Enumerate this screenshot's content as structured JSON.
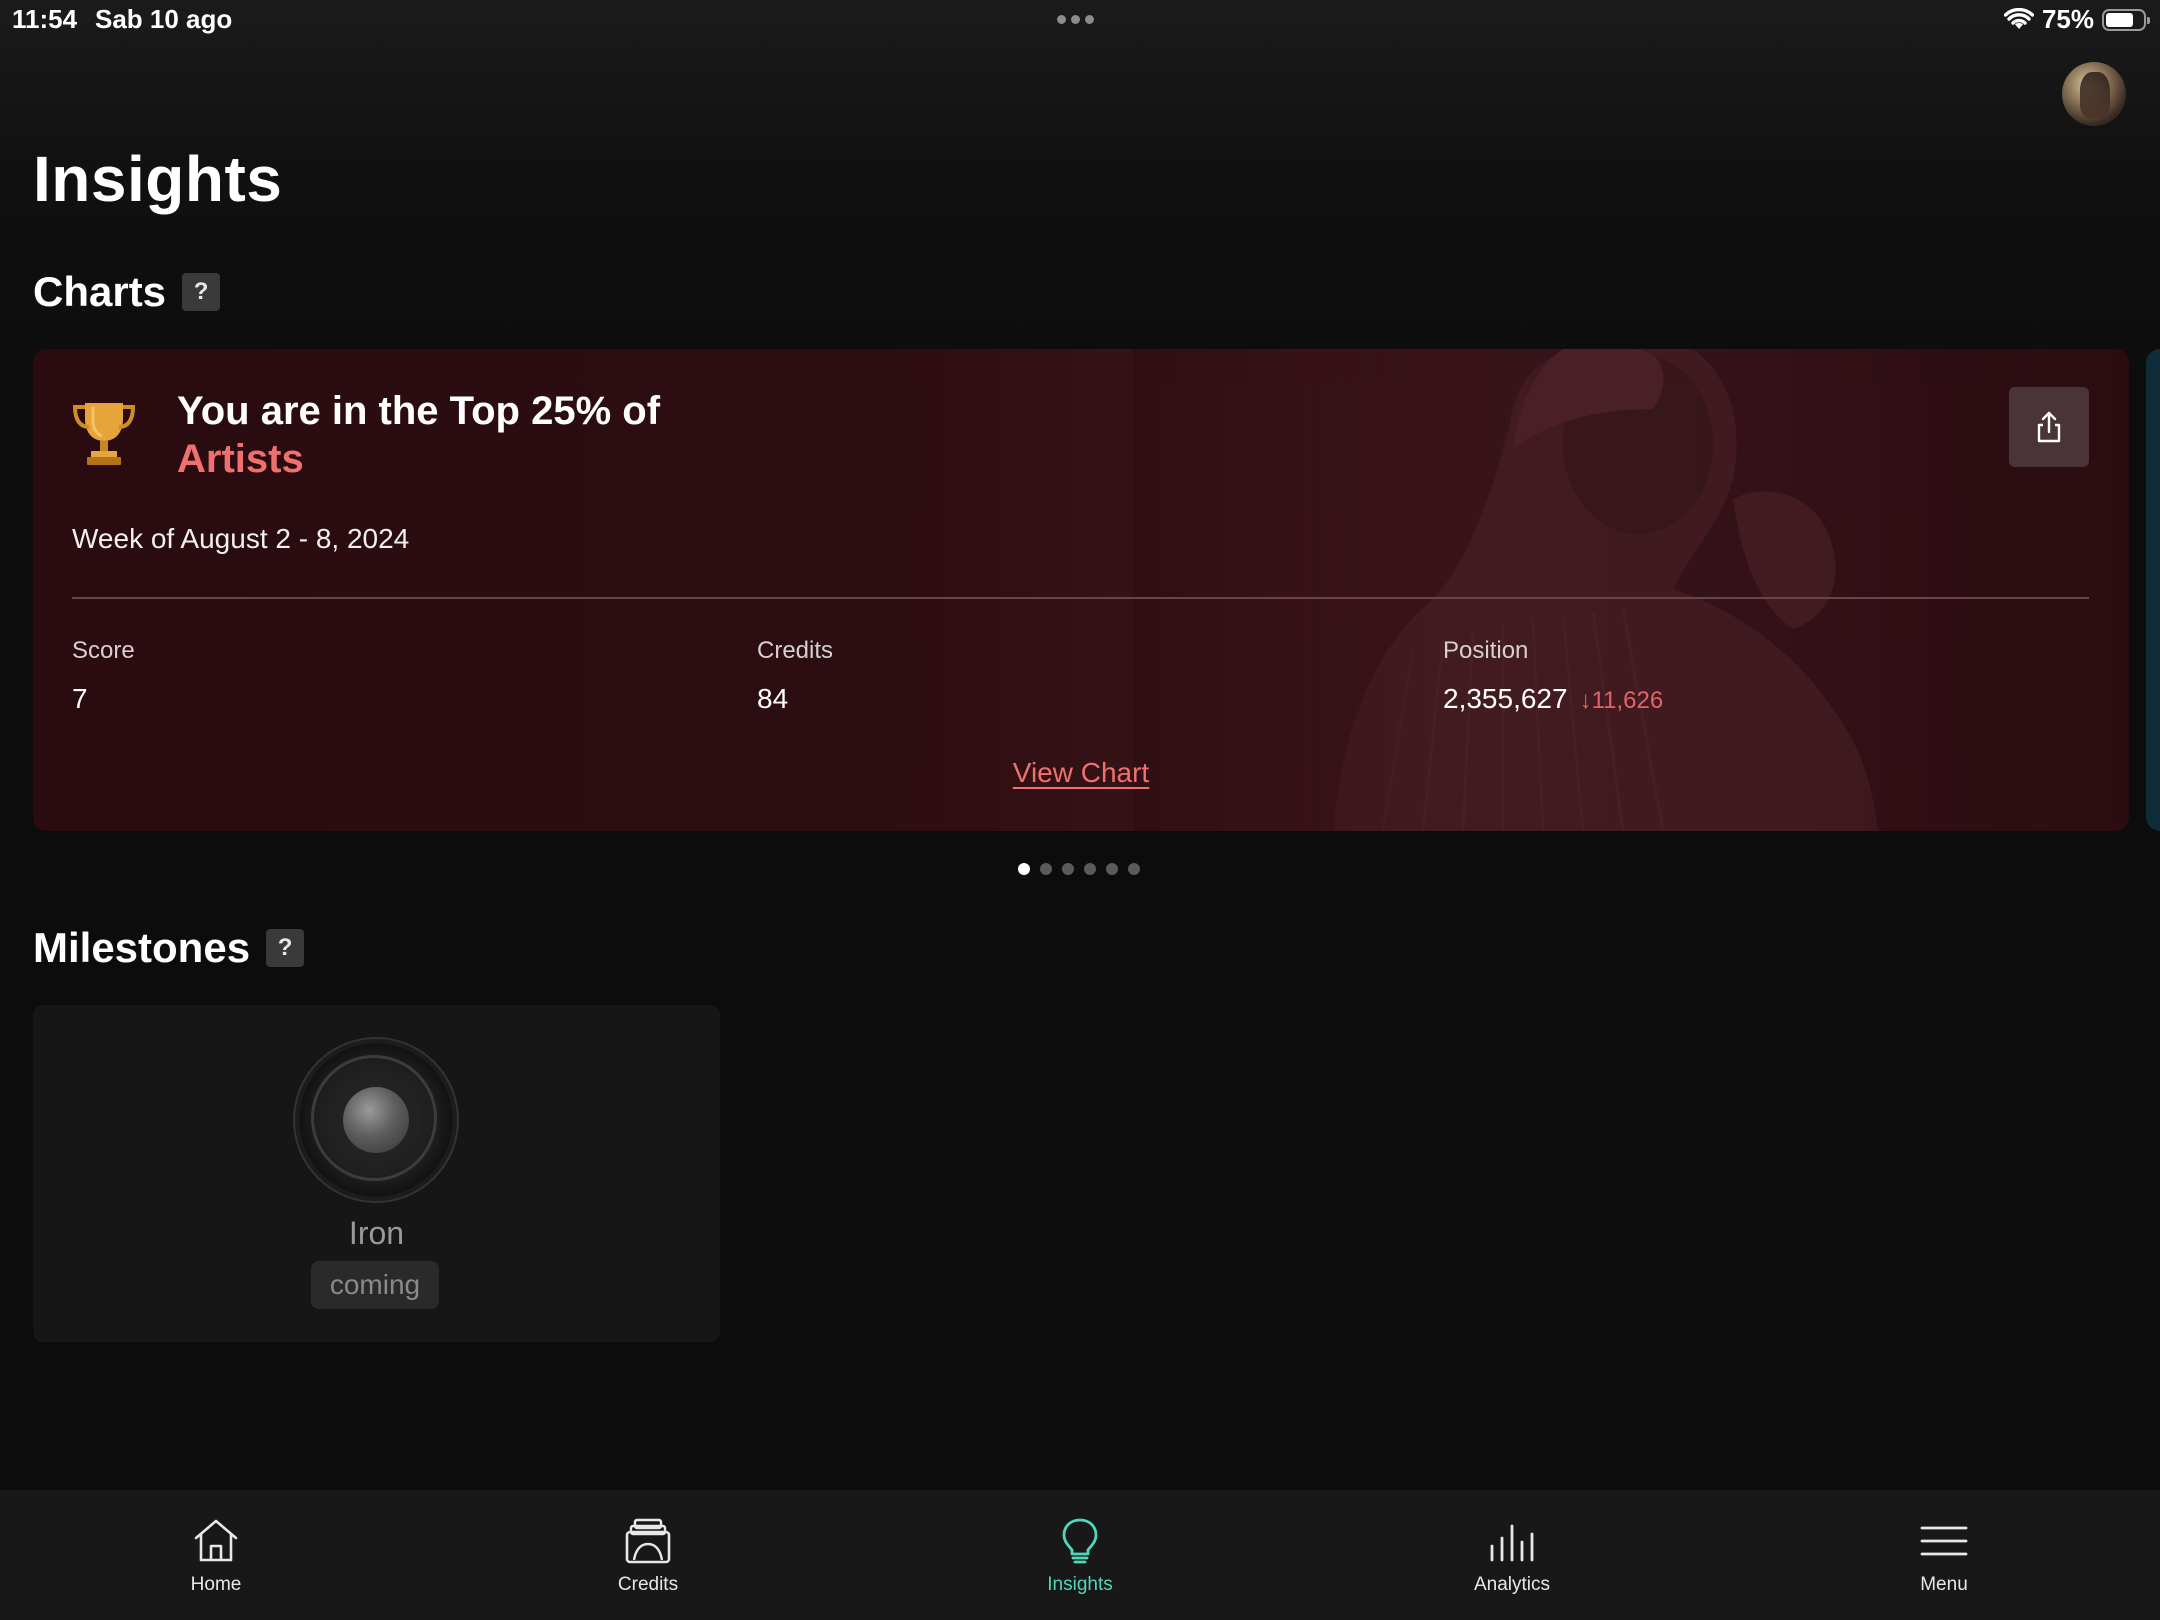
{
  "status_bar": {
    "time": "11:54",
    "date": "Sab 10 ago",
    "battery_percent": "75%",
    "battery_level": 0.75
  },
  "header": {
    "title": "Insights"
  },
  "charts_section": {
    "title": "Charts",
    "help": "?",
    "card": {
      "headline": "You are in the Top 25% of",
      "headline_accent": "Artists",
      "week": "Week of August 2 - 8, 2024",
      "stats": [
        {
          "label": "Score",
          "value": "7"
        },
        {
          "label": "Credits",
          "value": "84"
        },
        {
          "label": "Position",
          "value": "2,355,627",
          "delta": "↓11,626"
        }
      ],
      "link": "View Chart"
    },
    "pager": {
      "count": 6,
      "active": 0
    }
  },
  "milestones_section": {
    "title": "Milestones",
    "help": "?",
    "items": [
      {
        "name": "Iron",
        "status": "coming"
      }
    ]
  },
  "tab_bar": {
    "tabs": [
      {
        "label": "Home",
        "icon": "home-icon"
      },
      {
        "label": "Credits",
        "icon": "credits-icon"
      },
      {
        "label": "Insights",
        "icon": "lightbulb-icon",
        "active": true
      },
      {
        "label": "Analytics",
        "icon": "bar-chart-icon"
      },
      {
        "label": "Menu",
        "icon": "hamburger-menu-icon"
      }
    ]
  },
  "colors": {
    "accent_red": "#f07070",
    "active_tab": "#4fd7bb",
    "card_background": "#2c0d12"
  }
}
